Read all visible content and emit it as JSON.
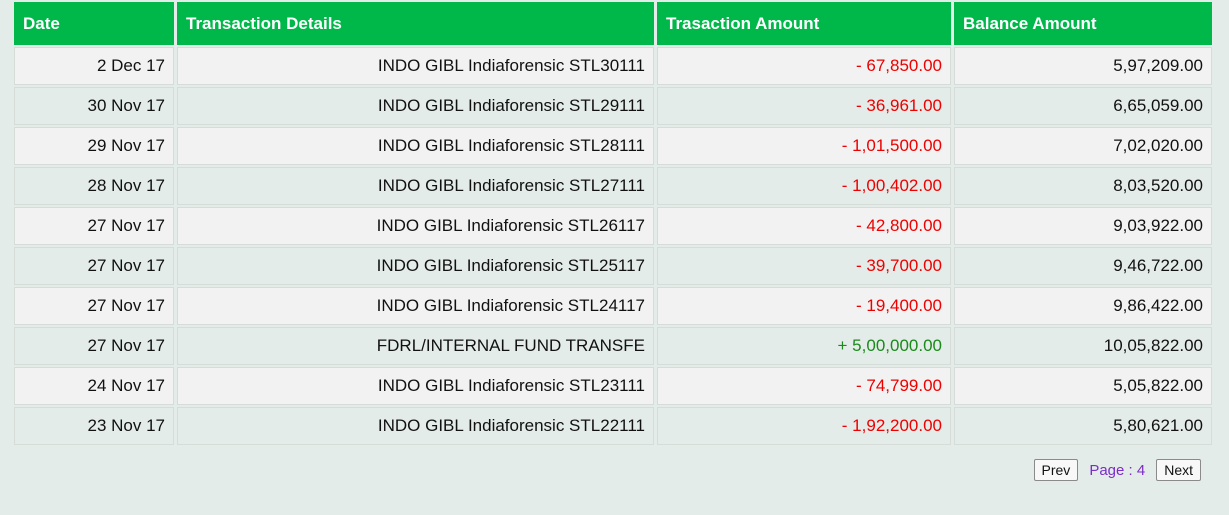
{
  "table": {
    "headers": [
      "Date",
      "Transaction Details",
      "Trasaction Amount",
      "Balance Amount"
    ],
    "rows": [
      {
        "date": "2 Dec 17",
        "details": "INDO GIBL Indiaforensic STL30111",
        "amount": "- 67,850.00",
        "type": "debit",
        "balance": "5,97,209.00"
      },
      {
        "date": "30 Nov 17",
        "details": "INDO GIBL Indiaforensic STL29111",
        "amount": "- 36,961.00",
        "type": "debit",
        "balance": "6,65,059.00"
      },
      {
        "date": "29 Nov 17",
        "details": "INDO GIBL Indiaforensic STL28111",
        "amount": "- 1,01,500.00",
        "type": "debit",
        "balance": "7,02,020.00"
      },
      {
        "date": "28 Nov 17",
        "details": "INDO GIBL Indiaforensic STL27111",
        "amount": "- 1,00,402.00",
        "type": "debit",
        "balance": "8,03,520.00"
      },
      {
        "date": "27 Nov 17",
        "details": "INDO GIBL Indiaforensic STL26117",
        "amount": "- 42,800.00",
        "type": "debit",
        "balance": "9,03,922.00"
      },
      {
        "date": "27 Nov 17",
        "details": "INDO GIBL Indiaforensic STL25117",
        "amount": "- 39,700.00",
        "type": "debit",
        "balance": "9,46,722.00"
      },
      {
        "date": "27 Nov 17",
        "details": "INDO GIBL Indiaforensic STL24117",
        "amount": "- 19,400.00",
        "type": "debit",
        "balance": "9,86,422.00"
      },
      {
        "date": "27 Nov 17",
        "details": "FDRL/INTERNAL FUND TRANSFE",
        "amount": "+ 5,00,000.00",
        "type": "credit",
        "balance": "10,05,822.00"
      },
      {
        "date": "24 Nov 17",
        "details": "INDO GIBL Indiaforensic STL23111",
        "amount": "- 74,799.00",
        "type": "debit",
        "balance": "5,05,822.00"
      },
      {
        "date": "23 Nov 17",
        "details": "INDO GIBL Indiaforensic STL22111",
        "amount": "- 1,92,200.00",
        "type": "debit",
        "balance": "5,80,621.00"
      }
    ]
  },
  "pagination": {
    "prev_label": "Prev",
    "page_label": "Page : 4",
    "next_label": "Next"
  },
  "colors": {
    "header_bg": "#00b84a",
    "debit": "#ee0000",
    "credit": "#1a8a1a",
    "page_label": "#7b2cc9",
    "background": "#e3ece8"
  }
}
